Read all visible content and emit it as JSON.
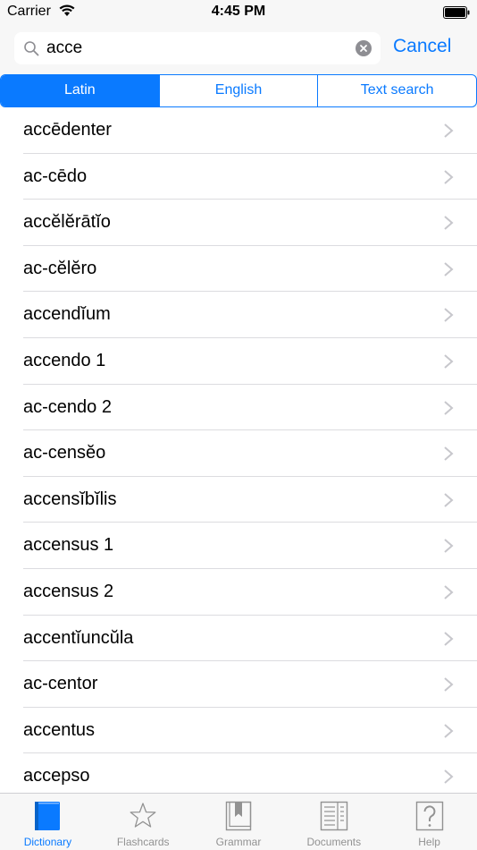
{
  "status_bar": {
    "carrier": "Carrier",
    "time": "4:45 PM"
  },
  "search": {
    "value": "acce",
    "cancel_label": "Cancel"
  },
  "segments": [
    {
      "label": "Latin",
      "active": true
    },
    {
      "label": "English",
      "active": false
    },
    {
      "label": "Text search",
      "active": false
    }
  ],
  "results": [
    "accēdenter",
    "ac-cēdo",
    "accĕlĕrātĭo",
    "ac-cĕlĕro",
    "accendĭum",
    "accendo 1",
    "ac-cendo 2",
    "ac-censĕo",
    "accensĭbĭlis",
    "accensus 1",
    "accensus 2",
    "accentĭuncŭla",
    "ac-centor",
    "accentus",
    "accepso"
  ],
  "tabs": [
    {
      "label": "Dictionary",
      "icon": "book-icon",
      "active": true
    },
    {
      "label": "Flashcards",
      "icon": "star-icon",
      "active": false
    },
    {
      "label": "Grammar",
      "icon": "bookmark-book-icon",
      "active": false
    },
    {
      "label": "Documents",
      "icon": "document-icon",
      "active": false
    },
    {
      "label": "Help",
      "icon": "question-icon",
      "active": false
    }
  ],
  "colors": {
    "accent": "#0a7aff",
    "inactive_tab": "#929292",
    "separator": "#dcdce0"
  }
}
